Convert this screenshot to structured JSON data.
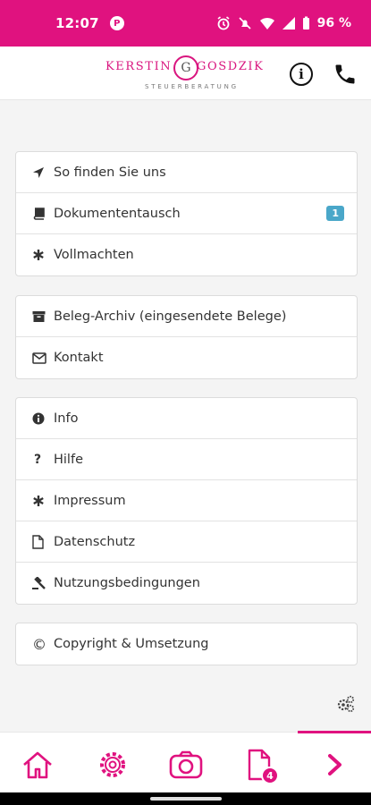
{
  "status_bar": {
    "time": "12:07",
    "battery": "96 %"
  },
  "header": {
    "logo_first": "KERSTIN",
    "logo_last": "GOSDZIK",
    "logo_monogram": "G",
    "logo_sub": "STEUERBERATUNG",
    "info_glyph": "i"
  },
  "menu": {
    "group1": [
      {
        "label": "So finden Sie uns",
        "icon": "location-arrow-icon"
      },
      {
        "label": "Dokumententausch",
        "icon": "book-icon",
        "badge": "1"
      },
      {
        "label": "Vollmachten",
        "icon": "asterisk-icon"
      }
    ],
    "group2": [
      {
        "label": "Beleg-Archiv (eingesendete Belege)",
        "icon": "archive-icon"
      },
      {
        "label": "Kontakt",
        "icon": "envelope-icon"
      }
    ],
    "group3": [
      {
        "label": "Info",
        "icon": "info-circle-icon"
      },
      {
        "label": "Hilfe",
        "icon": "question-icon",
        "glyph": "?"
      },
      {
        "label": "Impressum",
        "icon": "asterisk-icon"
      },
      {
        "label": "Datenschutz",
        "icon": "file-icon"
      },
      {
        "label": "Nutzungsbedingungen",
        "icon": "gavel-icon"
      }
    ],
    "group4": [
      {
        "label": "Copyright & Umsetzung",
        "icon": "copyright-icon",
        "glyph": "©"
      }
    ]
  },
  "tabbar": {
    "documents_count": "4",
    "active_tab": "more"
  },
  "colors": {
    "brand": "#e0127f",
    "badge": "#4aa7c9"
  }
}
